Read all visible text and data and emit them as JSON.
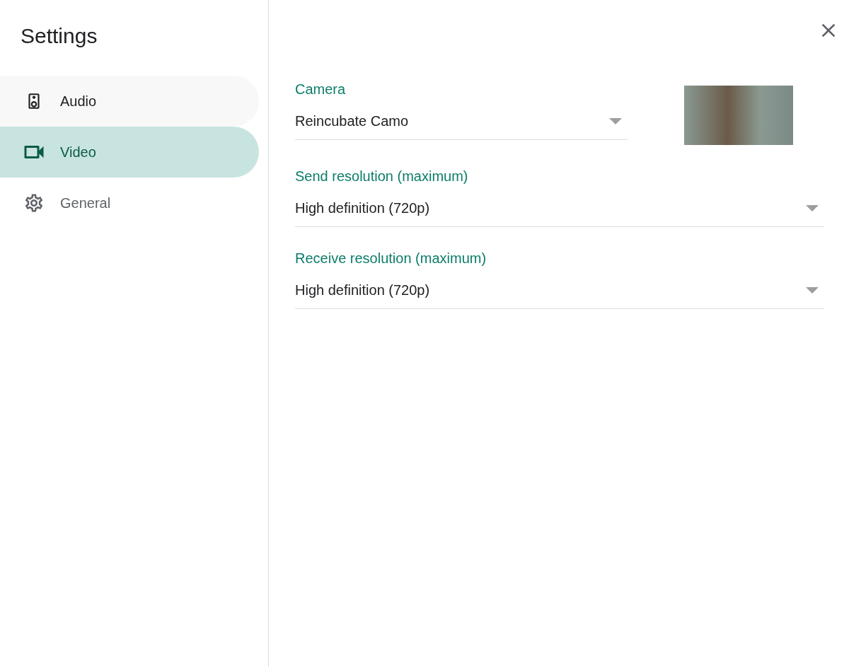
{
  "sidebar": {
    "title": "Settings",
    "items": [
      {
        "label": "Audio",
        "selected": false,
        "hovered": true
      },
      {
        "label": "Video",
        "selected": true,
        "hovered": false
      },
      {
        "label": "General",
        "selected": false,
        "hovered": false
      }
    ]
  },
  "fields": [
    {
      "kind": "camera",
      "label": "Camera",
      "value": "Reincubate Camo"
    },
    {
      "kind": "select",
      "label": "Send resolution (maximum)",
      "value": "High definition (720p)"
    },
    {
      "kind": "select",
      "label": "Receive resolution (maximum)",
      "value": "High definition (720p)"
    }
  ]
}
